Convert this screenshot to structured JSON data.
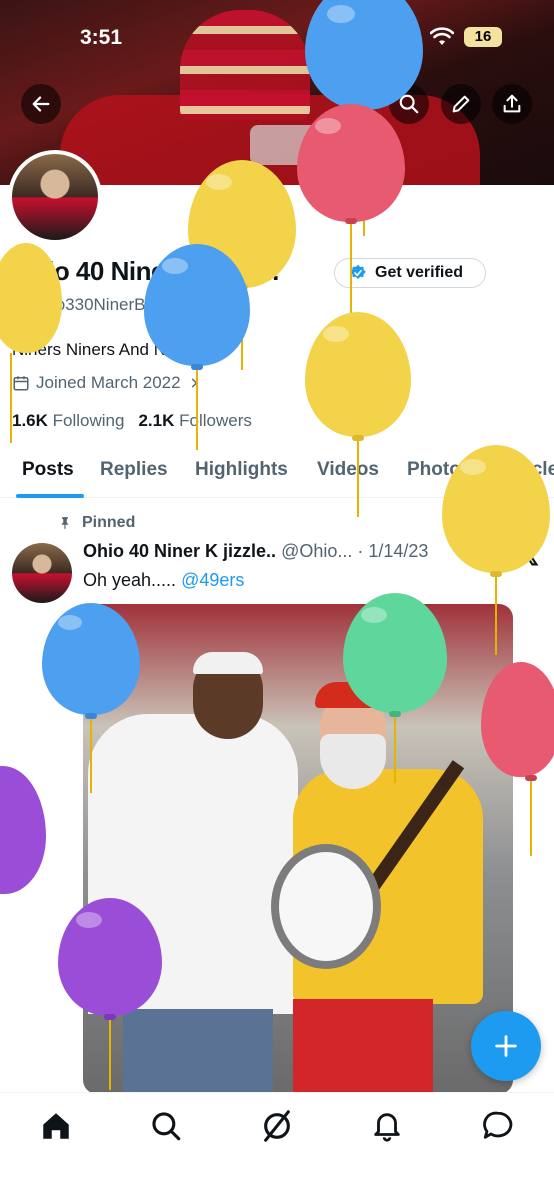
{
  "status_bar": {
    "time": "3:51",
    "battery": "16"
  },
  "profile": {
    "name": "Ohio 40 Niner K jizzle..",
    "handle": "@Ohio330NinerBoy",
    "bio": "Niners Niners And Niners",
    "joined": "Joined March 2022",
    "following_count": "1.6K",
    "following_label": "Following",
    "followers_count": "2.1K",
    "followers_label": "Followers",
    "verify_label": "Get verified"
  },
  "tabs": [
    "Posts",
    "Replies",
    "Highlights",
    "Videos",
    "Photos",
    "Articles"
  ],
  "pinned_label": "Pinned",
  "tweet": {
    "author": "Ohio 40 Niner K jizzle..",
    "handle": "@Ohio...",
    "date": "1/14/23",
    "text": "Oh yeah.....",
    "mention": "@49ers"
  },
  "colors": {
    "accent": "#1d9bf0",
    "text": "#0f1419",
    "muted": "#536471"
  },
  "icons": [
    "back-arrow-icon",
    "search-icon",
    "pencil-icon",
    "share-icon",
    "calendar-icon",
    "chevron-right-icon",
    "pin-icon",
    "x-logo-icon",
    "plus-icon",
    "home-icon",
    "grok-icon",
    "bell-icon",
    "chat-icon"
  ]
}
